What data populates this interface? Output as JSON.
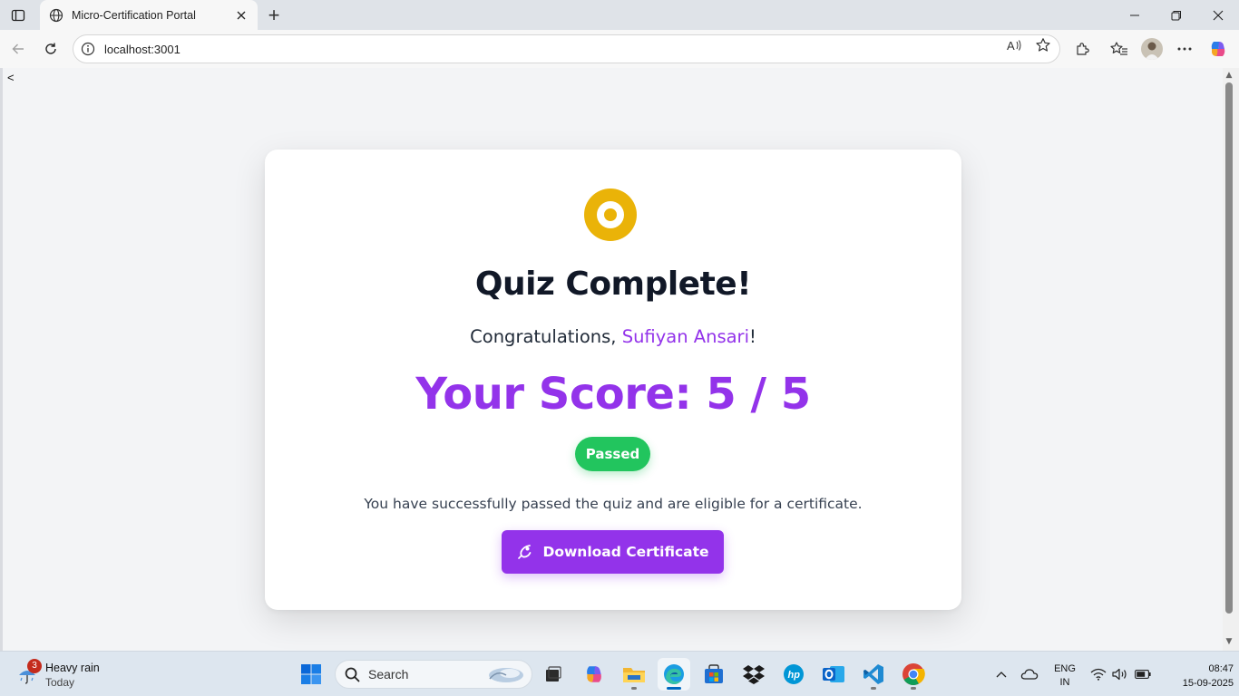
{
  "browser": {
    "tab_title": "Micro-Certification Portal",
    "new_tab_symbol": "+",
    "url": "localhost:3001"
  },
  "page": {
    "back_symbol": "<"
  },
  "result": {
    "icon": "medal-icon",
    "heading": "Quiz Complete!",
    "congrats_prefix": "Congratulations, ",
    "user_name": "Sufiyan Ansari",
    "congrats_suffix": "!",
    "score_text": "Your Score: 5 / 5",
    "status_badge": "Passed",
    "message": "You have successfully passed the quiz and are eligible for a certificate.",
    "download_button": "Download Certificate",
    "colors": {
      "accent": "#9333ea",
      "success": "#22c55e",
      "medal": "#eab308"
    }
  },
  "taskbar": {
    "weather_count": "3",
    "weather_line1": "Heavy rain",
    "weather_line2": "Today",
    "search_placeholder": "Search",
    "lang_line1": "ENG",
    "lang_line2": "IN",
    "time": "08:47",
    "date": "15-09-2025"
  }
}
